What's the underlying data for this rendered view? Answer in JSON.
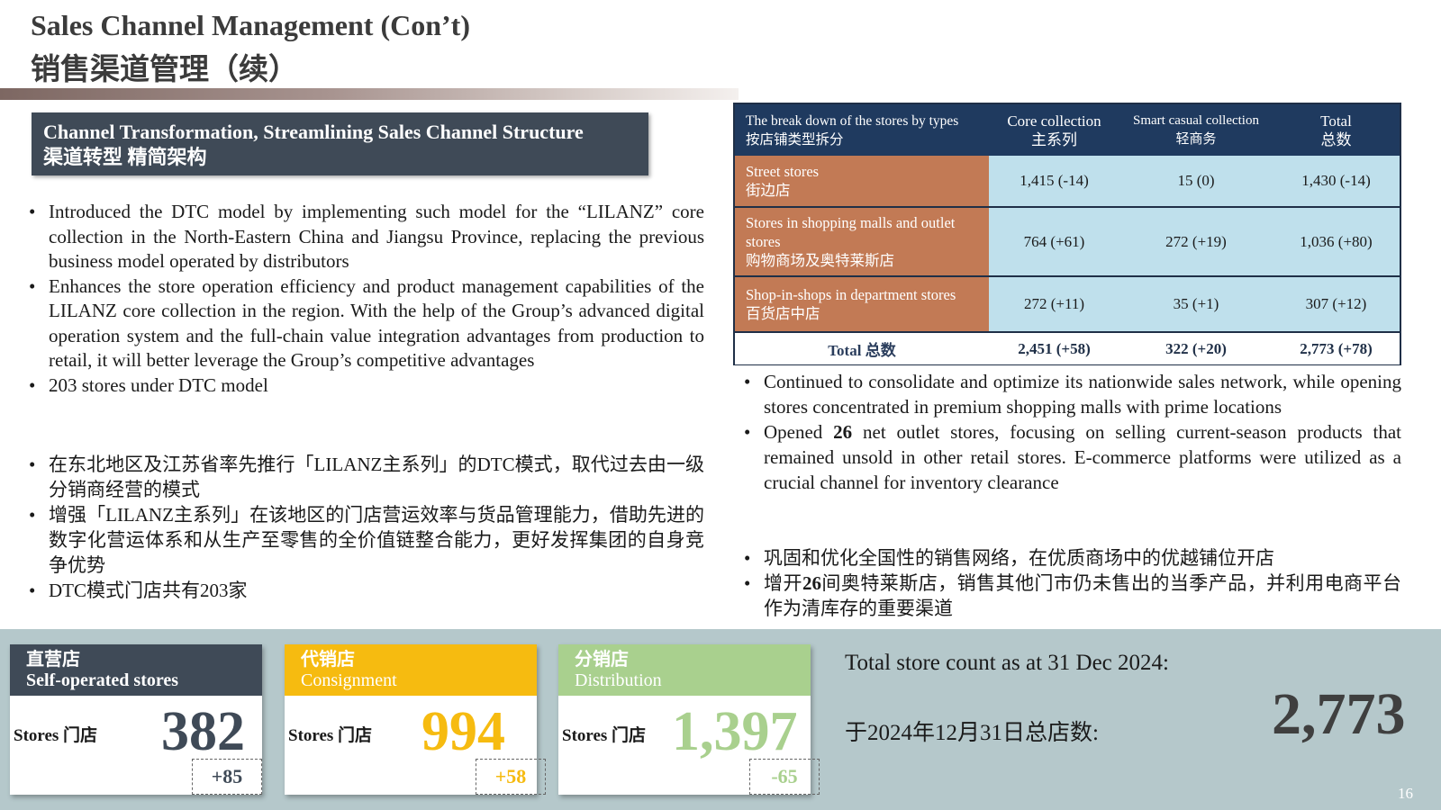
{
  "header": {
    "title_en": "Sales Channel Management (Con’t)",
    "title_cn": "销售渠道管理（续）"
  },
  "section": {
    "title_en": "Channel Transformation, Streamlining Sales Channel Structure",
    "title_cn": "渠道转型  精简架构"
  },
  "left_bullets_en": [
    "Introduced the DTC model by implementing such model for the “LILANZ” core collection in the North-Eastern China and Jiangsu Province, replacing the previous business model operated by distributors",
    "Enhances the store operation efficiency and product management capabilities of the LILANZ core collection in the region. With the help of the Group’s advanced digital operation system and the full-chain value integration advantages from production to retail, it will better leverage the Group’s competitive advantages",
    "203 stores under DTC model"
  ],
  "left_bullets_cn": [
    "在东北地区及江苏省率先推行「LILANZ主系列」的DTC模式，取代过去由一级分销商经营的模式",
    "增强「LILANZ主系列」在该地区的门店营运效率与货品管理能力，借助先进的数字化营运体系和从生产至零售的全价值链整合能力，更好发挥集团的自身竞争优势",
    "DTC模式门店共有203家"
  ],
  "table": {
    "headers": [
      {
        "en": "The break down of the stores by types",
        "cn": "按店铺类型拆分"
      },
      {
        "en": "Core collection",
        "cn": "主系列"
      },
      {
        "en": "Smart casual collection",
        "cn": "轻商务"
      },
      {
        "en": "Total",
        "cn": "总数"
      }
    ],
    "rows": [
      {
        "en": "Street stores",
        "cn": "街边店",
        "core": "1,415 (-14)",
        "smart": "15 (0)",
        "total": "1,430 (-14)"
      },
      {
        "en": "Stores in shopping malls and outlet stores",
        "cn": "购物商场及奥特莱斯店",
        "core": "764 (+61)",
        "smart": "272 (+19)",
        "total": "1,036 (+80)"
      },
      {
        "en": "Shop-in-shops in department stores",
        "cn": "百货店中店",
        "core": "272 (+11)",
        "smart": "35 (+1)",
        "total": "307 (+12)"
      }
    ],
    "total_row": {
      "label": "Total 总数",
      "core": "2,451 (+58)",
      "smart": "322 (+20)",
      "total": "2,773 (+78)"
    }
  },
  "right_bullets_en": {
    "b1": "Continued to consolidate and optimize its nationwide sales network, while opening stores concentrated in premium shopping malls with prime locations",
    "b2_pre": "Opened ",
    "b2_bold": "26",
    "b2_post": " net outlet stores, focusing on selling current-season products that remained unsold in other retail stores. E-commerce platforms were utilized as a crucial channel for inventory clearance"
  },
  "right_bullets_cn": {
    "b1": "巩固和优化全国性的销售网络，在优质商场中的优越铺位开店",
    "b2_pre": "增开",
    "b2_bold": "26",
    "b2_post": "间奥特莱斯店，销售其他门市仍未售出的当季产品，并利用电商平台作为清库存的重要渠道"
  },
  "cards": [
    {
      "cn": "直营店",
      "en": "Self-operated stores",
      "stores_label": "Stores 门店",
      "value": "382",
      "delta": "+85",
      "color": "#3f4a57"
    },
    {
      "cn": "代销店",
      "en": "Consignment",
      "stores_label": "Stores 门店",
      "value": "994",
      "delta": "+58",
      "color": "#f6bb10"
    },
    {
      "cn": "分销店",
      "en": "Distribution",
      "stores_label": "Stores 门店",
      "value": "1,397",
      "delta": "-65",
      "color": "#a9d08e"
    }
  ],
  "total_count": {
    "label_en": "Total store count as at 31 Dec 2024:",
    "label_cn": "于2024年12月31日总店数:",
    "value": "2,773"
  },
  "page_number": "16"
}
